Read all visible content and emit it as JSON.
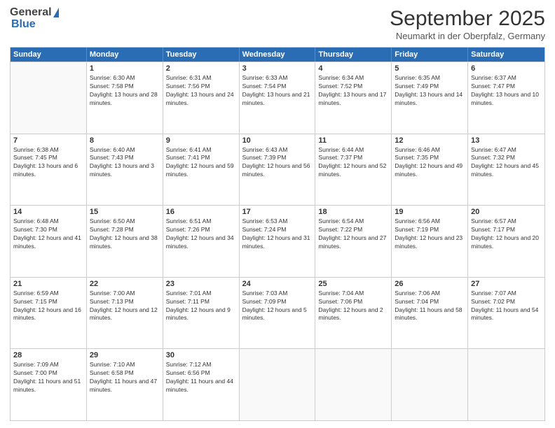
{
  "header": {
    "logo_general": "General",
    "logo_blue": "Blue",
    "month_title": "September 2025",
    "location": "Neumarkt in der Oberpfalz, Germany"
  },
  "weekdays": [
    "Sunday",
    "Monday",
    "Tuesday",
    "Wednesday",
    "Thursday",
    "Friday",
    "Saturday"
  ],
  "weeks": [
    [
      {
        "day": "",
        "sunrise": "",
        "sunset": "",
        "daylight": ""
      },
      {
        "day": "1",
        "sunrise": "Sunrise: 6:30 AM",
        "sunset": "Sunset: 7:58 PM",
        "daylight": "Daylight: 13 hours and 28 minutes."
      },
      {
        "day": "2",
        "sunrise": "Sunrise: 6:31 AM",
        "sunset": "Sunset: 7:56 PM",
        "daylight": "Daylight: 13 hours and 24 minutes."
      },
      {
        "day": "3",
        "sunrise": "Sunrise: 6:33 AM",
        "sunset": "Sunset: 7:54 PM",
        "daylight": "Daylight: 13 hours and 21 minutes."
      },
      {
        "day": "4",
        "sunrise": "Sunrise: 6:34 AM",
        "sunset": "Sunset: 7:52 PM",
        "daylight": "Daylight: 13 hours and 17 minutes."
      },
      {
        "day": "5",
        "sunrise": "Sunrise: 6:35 AM",
        "sunset": "Sunset: 7:49 PM",
        "daylight": "Daylight: 13 hours and 14 minutes."
      },
      {
        "day": "6",
        "sunrise": "Sunrise: 6:37 AM",
        "sunset": "Sunset: 7:47 PM",
        "daylight": "Daylight: 13 hours and 10 minutes."
      }
    ],
    [
      {
        "day": "7",
        "sunrise": "Sunrise: 6:38 AM",
        "sunset": "Sunset: 7:45 PM",
        "daylight": "Daylight: 13 hours and 6 minutes."
      },
      {
        "day": "8",
        "sunrise": "Sunrise: 6:40 AM",
        "sunset": "Sunset: 7:43 PM",
        "daylight": "Daylight: 13 hours and 3 minutes."
      },
      {
        "day": "9",
        "sunrise": "Sunrise: 6:41 AM",
        "sunset": "Sunset: 7:41 PM",
        "daylight": "Daylight: 12 hours and 59 minutes."
      },
      {
        "day": "10",
        "sunrise": "Sunrise: 6:43 AM",
        "sunset": "Sunset: 7:39 PM",
        "daylight": "Daylight: 12 hours and 56 minutes."
      },
      {
        "day": "11",
        "sunrise": "Sunrise: 6:44 AM",
        "sunset": "Sunset: 7:37 PM",
        "daylight": "Daylight: 12 hours and 52 minutes."
      },
      {
        "day": "12",
        "sunrise": "Sunrise: 6:46 AM",
        "sunset": "Sunset: 7:35 PM",
        "daylight": "Daylight: 12 hours and 49 minutes."
      },
      {
        "day": "13",
        "sunrise": "Sunrise: 6:47 AM",
        "sunset": "Sunset: 7:32 PM",
        "daylight": "Daylight: 12 hours and 45 minutes."
      }
    ],
    [
      {
        "day": "14",
        "sunrise": "Sunrise: 6:48 AM",
        "sunset": "Sunset: 7:30 PM",
        "daylight": "Daylight: 12 hours and 41 minutes."
      },
      {
        "day": "15",
        "sunrise": "Sunrise: 6:50 AM",
        "sunset": "Sunset: 7:28 PM",
        "daylight": "Daylight: 12 hours and 38 minutes."
      },
      {
        "day": "16",
        "sunrise": "Sunrise: 6:51 AM",
        "sunset": "Sunset: 7:26 PM",
        "daylight": "Daylight: 12 hours and 34 minutes."
      },
      {
        "day": "17",
        "sunrise": "Sunrise: 6:53 AM",
        "sunset": "Sunset: 7:24 PM",
        "daylight": "Daylight: 12 hours and 31 minutes."
      },
      {
        "day": "18",
        "sunrise": "Sunrise: 6:54 AM",
        "sunset": "Sunset: 7:22 PM",
        "daylight": "Daylight: 12 hours and 27 minutes."
      },
      {
        "day": "19",
        "sunrise": "Sunrise: 6:56 AM",
        "sunset": "Sunset: 7:19 PM",
        "daylight": "Daylight: 12 hours and 23 minutes."
      },
      {
        "day": "20",
        "sunrise": "Sunrise: 6:57 AM",
        "sunset": "Sunset: 7:17 PM",
        "daylight": "Daylight: 12 hours and 20 minutes."
      }
    ],
    [
      {
        "day": "21",
        "sunrise": "Sunrise: 6:59 AM",
        "sunset": "Sunset: 7:15 PM",
        "daylight": "Daylight: 12 hours and 16 minutes."
      },
      {
        "day": "22",
        "sunrise": "Sunrise: 7:00 AM",
        "sunset": "Sunset: 7:13 PM",
        "daylight": "Daylight: 12 hours and 12 minutes."
      },
      {
        "day": "23",
        "sunrise": "Sunrise: 7:01 AM",
        "sunset": "Sunset: 7:11 PM",
        "daylight": "Daylight: 12 hours and 9 minutes."
      },
      {
        "day": "24",
        "sunrise": "Sunrise: 7:03 AM",
        "sunset": "Sunset: 7:09 PM",
        "daylight": "Daylight: 12 hours and 5 minutes."
      },
      {
        "day": "25",
        "sunrise": "Sunrise: 7:04 AM",
        "sunset": "Sunset: 7:06 PM",
        "daylight": "Daylight: 12 hours and 2 minutes."
      },
      {
        "day": "26",
        "sunrise": "Sunrise: 7:06 AM",
        "sunset": "Sunset: 7:04 PM",
        "daylight": "Daylight: 11 hours and 58 minutes."
      },
      {
        "day": "27",
        "sunrise": "Sunrise: 7:07 AM",
        "sunset": "Sunset: 7:02 PM",
        "daylight": "Daylight: 11 hours and 54 minutes."
      }
    ],
    [
      {
        "day": "28",
        "sunrise": "Sunrise: 7:09 AM",
        "sunset": "Sunset: 7:00 PM",
        "daylight": "Daylight: 11 hours and 51 minutes."
      },
      {
        "day": "29",
        "sunrise": "Sunrise: 7:10 AM",
        "sunset": "Sunset: 6:58 PM",
        "daylight": "Daylight: 11 hours and 47 minutes."
      },
      {
        "day": "30",
        "sunrise": "Sunrise: 7:12 AM",
        "sunset": "Sunset: 6:56 PM",
        "daylight": "Daylight: 11 hours and 44 minutes."
      },
      {
        "day": "",
        "sunrise": "",
        "sunset": "",
        "daylight": ""
      },
      {
        "day": "",
        "sunrise": "",
        "sunset": "",
        "daylight": ""
      },
      {
        "day": "",
        "sunrise": "",
        "sunset": "",
        "daylight": ""
      },
      {
        "day": "",
        "sunrise": "",
        "sunset": "",
        "daylight": ""
      }
    ]
  ]
}
